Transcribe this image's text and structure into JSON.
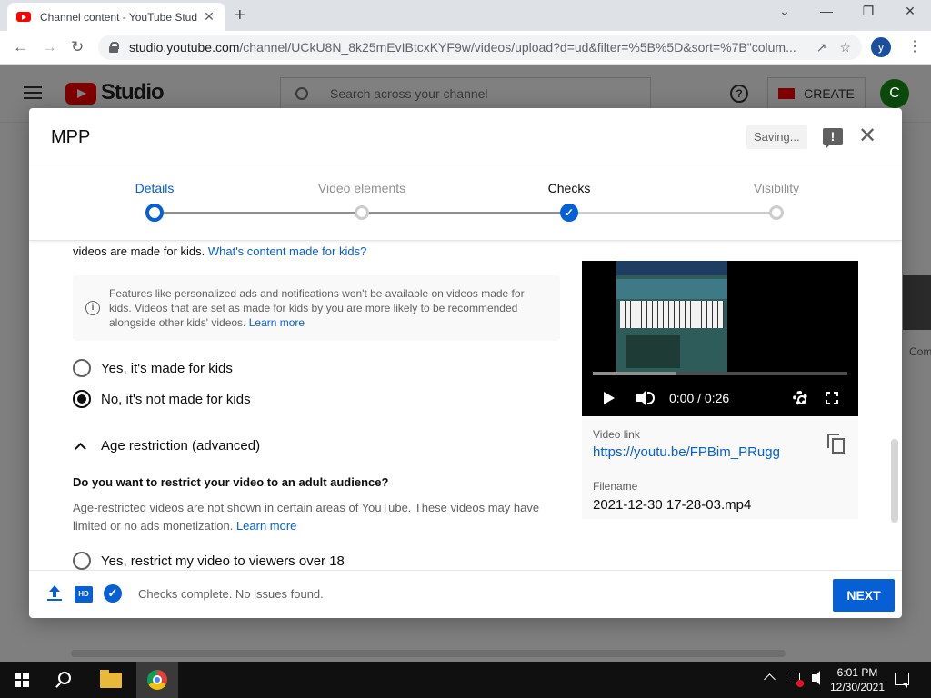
{
  "browser": {
    "tab_title": "Channel content - YouTube Stud",
    "tab_close": "✕",
    "new_tab": "+",
    "url_host": "studio.youtube.com",
    "url_path": "/channel/UCkU8N_8k25mEvIBtcxKYF9w/videos/upload?d=ud&filter=%5B%5D&sort=%7B\"colum...",
    "profile_initial": "y",
    "minimize": "⌄",
    "win_min": "—",
    "win_restore": "❐",
    "win_close": "✕"
  },
  "studio": {
    "logo_text": "Studio",
    "search_placeholder": "Search across your channel",
    "help": "?",
    "create_label": "CREATE",
    "avatar_initial": "C",
    "bg_text": "Com"
  },
  "modal": {
    "title": "MPP",
    "saving_label": "Saving...",
    "feedback_glyph": "!",
    "close_glyph": "✕",
    "steps": [
      {
        "label": "Details",
        "state": "current"
      },
      {
        "label": "Video elements",
        "state": "pending"
      },
      {
        "label": "Checks",
        "state": "done"
      },
      {
        "label": "Visibility",
        "state": "pending"
      }
    ],
    "kids_line_prefix": "videos are made for kids. ",
    "kids_link": "What's content made for kids?",
    "info_text": "Features like personalized ads and notifications won't be available on videos made for kids. Videos that are set as made for kids by you are more likely to be recommended alongside other kids' videos. ",
    "info_link": "Learn more",
    "radio_yes_kids": "Yes, it's made for kids",
    "radio_no_kids": "No, it's not made for kids",
    "age_section": "Age restriction (advanced)",
    "age_question": "Do you want to restrict your video to an adult audience?",
    "age_desc": "Age-restricted videos are not shown in certain areas of YouTube. These videos may have limited or no ads monetization. ",
    "age_link": "Learn more",
    "radio_restrict": "Yes, restrict my video to viewers over 18",
    "preview": {
      "time": "0:00 / 0:26",
      "progress_buffered": 0.33,
      "video_link_label": "Video link",
      "video_link": "https://youtu.be/FPBim_PRugg",
      "filename_label": "Filename",
      "filename": "2021-12-30 17-28-03.mp4"
    },
    "footer": {
      "hd_label": "HD",
      "checks_status": "Checks complete. No issues found.",
      "next_label": "NEXT"
    }
  },
  "taskbar": {
    "time": "6:01 PM",
    "date": "12/30/2021"
  },
  "colors": {
    "accent": "#065fd4",
    "youtube_red": "#ff0000"
  }
}
